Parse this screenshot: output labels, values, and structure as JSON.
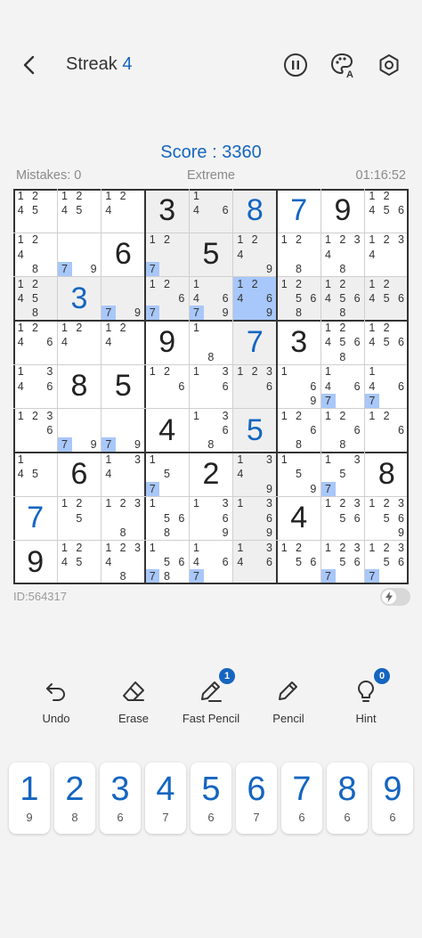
{
  "header": {
    "streak_label": "Streak",
    "streak_count": "4",
    "icons": [
      "back-arrow-icon",
      "pause-icon",
      "palette-icon",
      "settings-icon"
    ]
  },
  "score": "Score : 3360",
  "status": {
    "mistakes": "Mistakes: 0",
    "difficulty": "Extreme",
    "timer": "01:16:52"
  },
  "game_id": "ID:564317",
  "board": {
    "selected": [
      2,
      5
    ],
    "rows": [
      [
        {
          "n": "1245"
        },
        {
          "n": "1245"
        },
        {
          "n": "124"
        },
        {
          "g": 3
        },
        {
          "n": "146"
        },
        {
          "u": 8
        },
        {
          "u": 7
        },
        {
          "g": 9
        },
        {
          "n": "12456"
        }
      ],
      [
        {
          "n": "1248"
        },
        {
          "n": "79",
          "h": "7"
        },
        {
          "g": 6
        },
        {
          "n": "127",
          "h": "7"
        },
        {
          "g": 5
        },
        {
          "n": "1249"
        },
        {
          "n": "128"
        },
        {
          "n": "12348"
        },
        {
          "n": "1234"
        }
      ],
      [
        {
          "n": "12458"
        },
        {
          "u": 3
        },
        {
          "n": "79",
          "h": "7"
        },
        {
          "n": "1267",
          "h": "7"
        },
        {
          "n": "146979",
          "h": "7"
        },
        {
          "n": "12469"
        },
        {
          "n": "12568"
        },
        {
          "n": "124568"
        },
        {
          "n": "12456"
        }
      ],
      [
        {
          "n": "1246"
        },
        {
          "n": "124"
        },
        {
          "n": "124"
        },
        {
          "g": 9
        },
        {
          "n": "18"
        },
        {
          "u": 7
        },
        {
          "g": 3
        },
        {
          "n": "124568"
        },
        {
          "n": "12456"
        }
      ],
      [
        {
          "n": "1346"
        },
        {
          "g": 8
        },
        {
          "g": 5
        },
        {
          "n": "126"
        },
        {
          "n": "136"
        },
        {
          "n": "1236"
        },
        {
          "n": "169"
        },
        {
          "n": "1467",
          "h": "7"
        },
        {
          "n": "1467",
          "h": "7"
        }
      ],
      [
        {
          "n": "1236"
        },
        {
          "n": "79",
          "h": "7"
        },
        {
          "n": "79",
          "h": "7"
        },
        {
          "g": 4
        },
        {
          "n": "1368"
        },
        {
          "u": 5
        },
        {
          "n": "1268"
        },
        {
          "n": "1268"
        },
        {
          "n": "126"
        }
      ],
      [
        {
          "n": "145"
        },
        {
          "g": 6
        },
        {
          "n": "134"
        },
        {
          "n": "157",
          "h": "7"
        },
        {
          "g": 2
        },
        {
          "n": "1349"
        },
        {
          "n": "159"
        },
        {
          "n": "1357",
          "h": "7"
        },
        {
          "g": 8
        }
      ],
      [
        {
          "u": 7
        },
        {
          "n": "125"
        },
        {
          "n": "1238"
        },
        {
          "n": "1568"
        },
        {
          "n": "1369"
        },
        {
          "n": "1369"
        },
        {
          "g": 4
        },
        {
          "n": "12356"
        },
        {
          "n": "123569"
        }
      ],
      [
        {
          "g": 9
        },
        {
          "n": "1245"
        },
        {
          "n": "12348"
        },
        {
          "n": "15678",
          "h": "7"
        },
        {
          "n": "1467",
          "h": "7"
        },
        {
          "n": "1346"
        },
        {
          "n": "1256"
        },
        {
          "n": "123567",
          "h": "7"
        },
        {
          "n": "123567",
          "h": "7"
        }
      ]
    ]
  },
  "tools": [
    {
      "label": "Undo",
      "icon": "undo-icon"
    },
    {
      "label": "Erase",
      "icon": "eraser-icon"
    },
    {
      "label": "Fast Pencil",
      "icon": "fast-pencil-icon",
      "badge": "1"
    },
    {
      "label": "Pencil",
      "icon": "pencil-icon"
    },
    {
      "label": "Hint",
      "icon": "lightbulb-icon",
      "badge": "0"
    }
  ],
  "numpad": [
    {
      "digit": "1",
      "remaining": "9"
    },
    {
      "digit": "2",
      "remaining": "8"
    },
    {
      "digit": "3",
      "remaining": "6"
    },
    {
      "digit": "4",
      "remaining": "7"
    },
    {
      "digit": "5",
      "remaining": "6"
    },
    {
      "digit": "6",
      "remaining": "7"
    },
    {
      "digit": "7",
      "remaining": "6"
    },
    {
      "digit": "8",
      "remaining": "6"
    },
    {
      "digit": "9",
      "remaining": "6"
    }
  ],
  "colors": {
    "accent": "#1565c0",
    "highlight": "#a8c7fa",
    "peer": "#efefef"
  }
}
